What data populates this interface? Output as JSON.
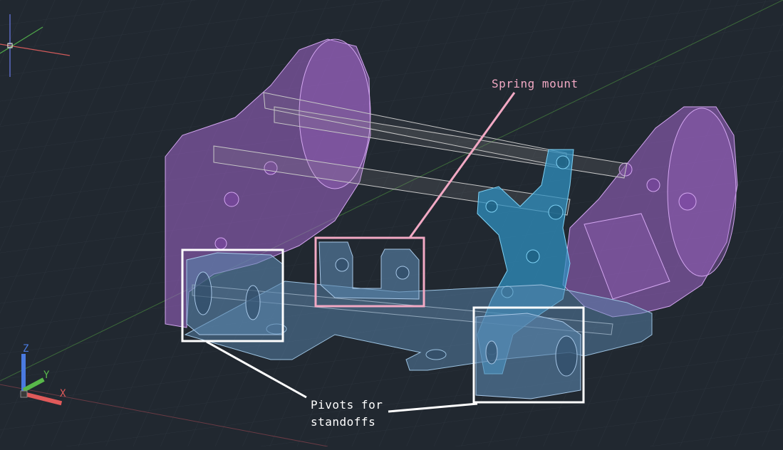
{
  "annotations": {
    "spring_mount": "Spring mount",
    "pivots_line1": "Pivots for",
    "pivots_line2": "standoffs"
  },
  "ucs": {
    "x_label": "X",
    "y_label": "Y",
    "z_label": "Z"
  },
  "colors": {
    "background": "#212830",
    "grid": "#2c343d",
    "plate_purple": "#a366cc",
    "bracket_blue": "#2f8fbf",
    "base_blue": "#6a93b8",
    "spring_box": "#f2a9c4",
    "pivot_box": "#ffffff",
    "axis_x": "#e05a5a",
    "axis_y": "#58b84a",
    "axis_z": "#4a7ae0"
  },
  "icons": [
    "ucs-axis-icon",
    "crosshair-icon"
  ]
}
